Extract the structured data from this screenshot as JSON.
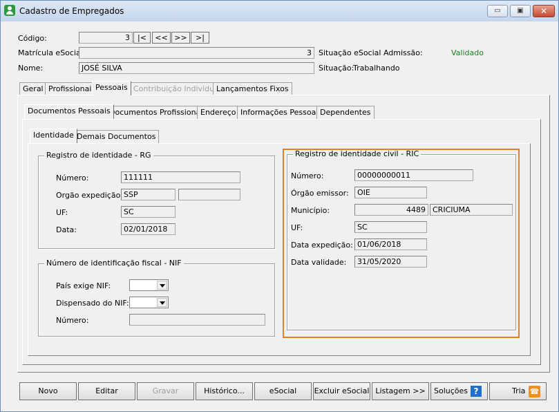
{
  "window": {
    "title": "Cadastro de Empregados",
    "controls": {
      "minimize": "▭",
      "maximize": "▣",
      "close": "✕"
    }
  },
  "header": {
    "codigo_label": "Código:",
    "codigo_value": "3",
    "nav": [
      "|<",
      "<<",
      ">>",
      ">|"
    ],
    "matricula_label": "Matrícula eSocial:",
    "matricula_value": "3",
    "situacao_admissao_label": "Situação eSocial Admissão:",
    "situacao_admissao_value": "Validado",
    "nome_label": "Nome:",
    "nome_value": "JOSÉ SILVA",
    "situacao_label": "Situação:",
    "situacao_value": "Trabalhando"
  },
  "main_tabs": [
    "Geral",
    "Profissionais",
    "Pessoais",
    "Contribuição Individual",
    "Lançamentos Fixos"
  ],
  "sub_tabs": [
    "Documentos Pessoais",
    "Documentos Profissionais",
    "Endereço",
    "Informações Pessoais",
    "Dependentes"
  ],
  "doc_tabs": [
    "Identidade",
    "Demais Documentos"
  ],
  "rg": {
    "title": "Registro de identidade - RG",
    "numero_label": "Número:",
    "numero_value": "111111",
    "orgao_label": "Orgão expedição:",
    "orgao_value": "SSP",
    "orgao_extra": "",
    "uf_label": "UF:",
    "uf_value": "SC",
    "data_label": "Data:",
    "data_value": "02/01/2018"
  },
  "nif": {
    "title": "Número de identificação fiscal - NIF",
    "pais_label": "País exige NIF:",
    "dispensado_label": "Dispensado do NIF:",
    "numero_label": "Número:"
  },
  "ric": {
    "title": "Registro de identidade civil - RIC",
    "numero_label": "Número:",
    "numero_value": "00000000011",
    "orgao_label": "Órgão emissor:",
    "orgao_value": "OIE",
    "municipio_label": "Município:",
    "municipio_code": "4489",
    "municipio_name": "CRICIUMA",
    "uf_label": "UF:",
    "uf_value": "SC",
    "data_exp_label": "Data expedição:",
    "data_exp_value": "01/06/2018",
    "data_val_label": "Data validade:",
    "data_val_value": "31/05/2020"
  },
  "buttons": {
    "novo": "Novo",
    "editar": "Editar",
    "gravar": "Gravar",
    "historico": "Histórico...",
    "esocial": "eSocial",
    "excluir": "Excluir eSocial",
    "listagem": "Listagem >>",
    "solucoes": "Soluções",
    "tria": "Tria"
  },
  "colors": {
    "accent": "#e67e22",
    "validado": "#1a7f1a",
    "help": "#1e6fc9"
  }
}
